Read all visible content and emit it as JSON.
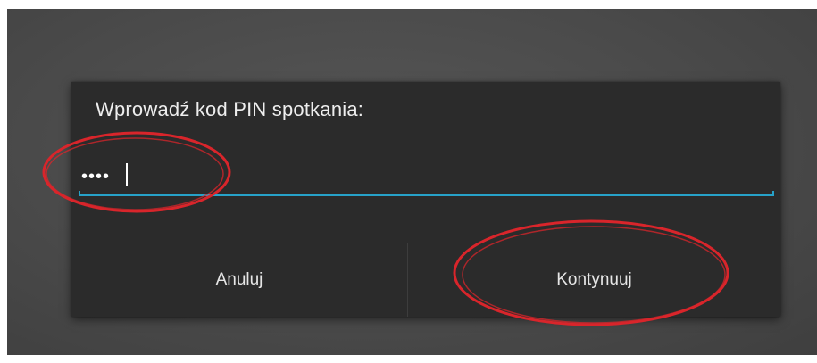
{
  "dialog": {
    "title": "Wprowadź kod PIN spotkania:",
    "pin_value": "••••",
    "cancel_label": "Anuluj",
    "continue_label": "Kontynuuj"
  },
  "colors": {
    "dialog_background": "#2b2b2b",
    "screen_background": "#4b4b4b",
    "accent": "#27a2c9",
    "annotation": "#d9252b"
  }
}
